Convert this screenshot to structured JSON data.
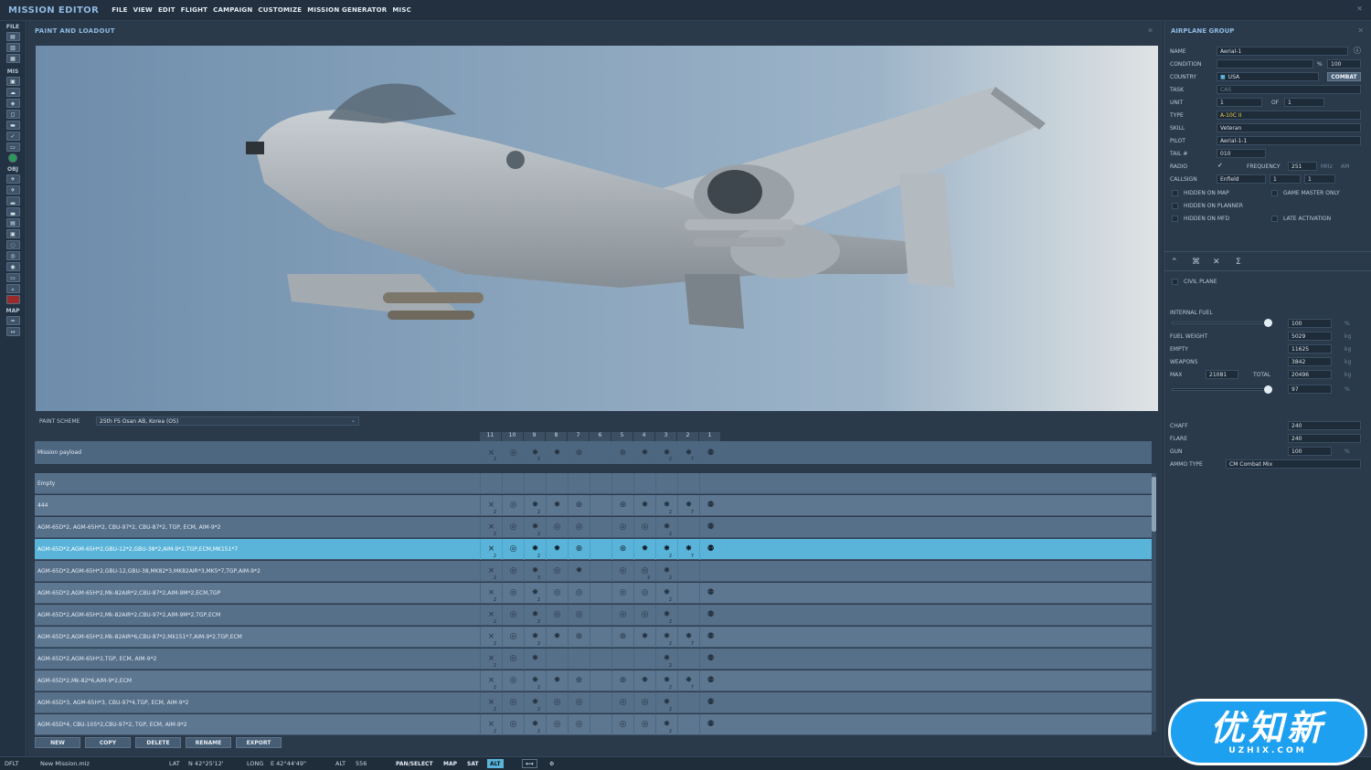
{
  "app": {
    "title": "MISSION EDITOR"
  },
  "menu": [
    "FILE",
    "VIEW",
    "EDIT",
    "FLIGHT",
    "CAMPAIGN",
    "CUSTOMIZE",
    "MISSION GENERATOR",
    "MISC"
  ],
  "left_toolbar": {
    "file": "FILE",
    "mis": "MIS",
    "obj": "OBJ",
    "map": "MAP"
  },
  "center": {
    "title": "PAINT AND LOADOUT",
    "paint_scheme_label": "PAINT SCHEME",
    "paint_scheme_value": "25th FS Osan AB, Korea (OS)",
    "pylons": [
      "11",
      "10",
      "9",
      "8",
      "7",
      "6",
      "5",
      "4",
      "3",
      "2",
      "1"
    ],
    "payload_label": "Mission payload",
    "rows": [
      {
        "label": "Empty",
        "pattern": "none"
      },
      {
        "label": "444",
        "pattern": "full"
      },
      {
        "label": "AGM-65D*2, AGM-65H*2, CBU-97*2, CBU-87*2, TGP, ECM, AIM-9*2",
        "pattern": "std"
      },
      {
        "label": "AGM-65D*2,AGM-65H*2,GBU-12*2,GBU-38*2,AIM-9*2,TGP,ECM,MK151*7",
        "pattern": "full",
        "selected": true
      },
      {
        "label": "AGM-65D*2,AGM-65H*2,GBU-12,GBU-38,MK82*3,MK82AIR*3,MK5*7,TGP,AIM-9*2",
        "pattern": "mid"
      },
      {
        "label": "AGM-65D*2,AGM-65H*2,Mk-82AIR*2,CBU-87*2,AIM-9M*2,ECM,TGP",
        "pattern": "std"
      },
      {
        "label": "AGM-65D*2,AGM-65H*2,Mk-82AIR*2,CBU-97*2,AIM-9M*2,TGP,ECM",
        "pattern": "std"
      },
      {
        "label": "AGM-65D*2,AGM-65H*2,Mk-82AIR*6,CBU-87*2,Mk151*7,AIM-9*2,TGP,ECM",
        "pattern": "full"
      },
      {
        "label": "AGM-65D*2,AGM-65H*2,TGP, ECM, AIM-9*2",
        "pattern": "light"
      },
      {
        "label": "AGM-65D*2,Mk-82*6,AIM-9*2,ECM",
        "pattern": "full"
      },
      {
        "label": "AGM-65D*3, AGM-65H*3, CBU-97*4,TGP, ECM, AIM-9*2",
        "pattern": "std"
      },
      {
        "label": "AGM-65D*4, CBU-105*2,CBU-97*2, TGP, ECM, AIM-9*2",
        "pattern": "std"
      }
    ],
    "buttons": [
      "NEW",
      "COPY",
      "DELETE",
      "RENAME",
      "EXPORT"
    ]
  },
  "right": {
    "title": "AIRPLANE GROUP",
    "name_label": "NAME",
    "name_value": "Aerial-1",
    "condition_label": "CONDITION",
    "condition_pct": "%",
    "condition_value": "100",
    "country_label": "COUNTRY",
    "country_value": "USA",
    "combat_label": "COMBAT",
    "task_label": "TASK",
    "task_value": "CAS",
    "unit_label": "UNIT",
    "unit_value": "1",
    "unit_of": "OF",
    "unit_total": "1",
    "type_label": "TYPE",
    "type_value": "A-10C II",
    "skill_label": "SKILL",
    "skill_value": "Veteran",
    "pilot_label": "PILOT",
    "pilot_value": "Aerial-1-1",
    "tail_label": "TAIL #",
    "tail_value": "010",
    "radio_label": "RADIO",
    "frequency_label": "FREQUENCY",
    "frequency_value": "251",
    "mhz": "MHz",
    "am": "AM",
    "callsign_label": "CALLSIGN",
    "callsign_value": "Enfield",
    "callsign_n1": "1",
    "callsign_n2": "1",
    "hidden_map": "HIDDEN ON MAP",
    "game_master": "GAME MASTER ONLY",
    "hidden_planner": "HIDDEN ON PLANNER",
    "hidden_mfd": "HIDDEN ON MFD",
    "late_activation": "LATE ACTIVATION",
    "civil_plane": "CIVIL PLANE",
    "internal_fuel_label": "INTERNAL FUEL",
    "internal_fuel_value": "100",
    "pct": "%",
    "fuel_weight_label": "FUEL WEIGHT",
    "fuel_weight_value": "5029",
    "kg": "kg",
    "empty_label": "EMPTY",
    "empty_value": "11625",
    "weapons_label": "WEAPONS",
    "weapons_value": "3842",
    "max_label": "MAX",
    "max_value": "21081",
    "total_label": "TOTAL",
    "total_value": "20496",
    "load_pct_value": "97",
    "chaff_label": "CHAFF",
    "chaff_value": "240",
    "flare_label": "FLARE",
    "flare_value": "240",
    "gun_label": "GUN",
    "gun_value": "100",
    "ammo_label": "AMMO TYPE",
    "ammo_value": "CM Combat Mix",
    "internal_fuel_level": 0.95,
    "load_level": 0.97
  },
  "status": {
    "dflt": "DFLT",
    "file": "New Mission.miz",
    "lat_label": "LAT",
    "lat_value": "N 42°25'12'",
    "long_label": "LONG",
    "long_value": "E 42°44'49\"",
    "alt_label": "ALT",
    "alt_value": "556",
    "pan": "PAN/SELECT",
    "map": "MAP",
    "sat": "SAT",
    "alt_btn": "ALT"
  },
  "watermark": {
    "main": "优知新",
    "sub": "UZHIX.COM"
  },
  "colors": {
    "accent": "#5ab4d9",
    "title": "#8fb8e0",
    "panel": "#2a3a4b"
  }
}
